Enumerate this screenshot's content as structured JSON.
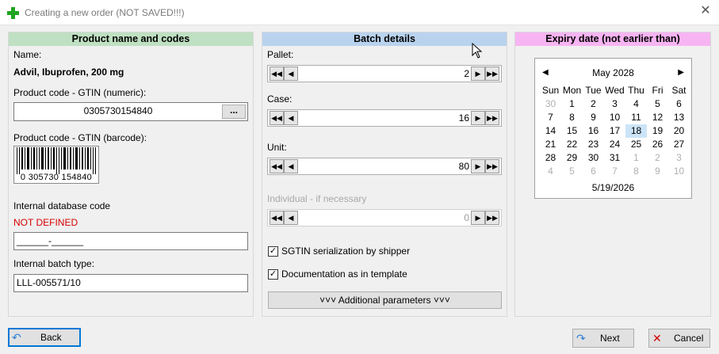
{
  "window": {
    "title": "Creating a new order (NOT SAVED!!!)"
  },
  "product": {
    "header": "Product name and codes",
    "name_label": "Name:",
    "name_value": "Advil, Ibuprofen, 200 mg",
    "gtin_numeric_label": "Product code - GTIN (numeric):",
    "gtin_numeric_value": "0305730154840",
    "gtin_browse_label": "...",
    "gtin_barcode_label": "Product code - GTIN (barcode):",
    "barcode_text": "0 305730 154840",
    "internal_db_label": "Internal database code",
    "internal_db_status": "NOT DEFINED",
    "internal_db_value": "______-______",
    "batch_type_label": "Internal batch type:",
    "batch_type_value": "LLL-005571/10"
  },
  "batch": {
    "header": "Batch details",
    "pallet_label": "Pallet:",
    "pallet_value": "2",
    "case_label": "Case:",
    "case_value": "16",
    "unit_label": "Unit:",
    "unit_value": "80",
    "individual_label": "Individual - if necessary",
    "individual_value": "0",
    "sgtin_label": "SGTIN serialization by shipper",
    "sgtin_checked": true,
    "doc_label": "Documentation as in template",
    "doc_checked": true,
    "additional_label": "˅˅˅   Additional parameters   ˅˅˅"
  },
  "expiry": {
    "header": "Expiry date (not earlier than)",
    "month_title": "May 2028",
    "weekdays": [
      "Sun",
      "Mon",
      "Tue",
      "Wed",
      "Thu",
      "Fri",
      "Sat"
    ],
    "weeks": [
      [
        "30",
        "1",
        "2",
        "3",
        "4",
        "5",
        "6"
      ],
      [
        "7",
        "8",
        "9",
        "10",
        "11",
        "12",
        "13"
      ],
      [
        "14",
        "15",
        "16",
        "17",
        "18",
        "19",
        "20"
      ],
      [
        "21",
        "22",
        "23",
        "24",
        "25",
        "26",
        "27"
      ],
      [
        "28",
        "29",
        "30",
        "31",
        "1",
        "2",
        "3"
      ],
      [
        "4",
        "5",
        "6",
        "7",
        "8",
        "9",
        "10"
      ]
    ],
    "selected_day": "18",
    "today_text": "5/19/2026"
  },
  "footer": {
    "back_label": "Back",
    "next_label": "Next",
    "cancel_label": "Cancel"
  },
  "colors": {
    "product_header": "#bfe0c2",
    "batch_header": "#b9d3ee",
    "expiry_header": "#f7b4f2",
    "error_text": "#d40000",
    "focus_border": "#0078d7"
  }
}
